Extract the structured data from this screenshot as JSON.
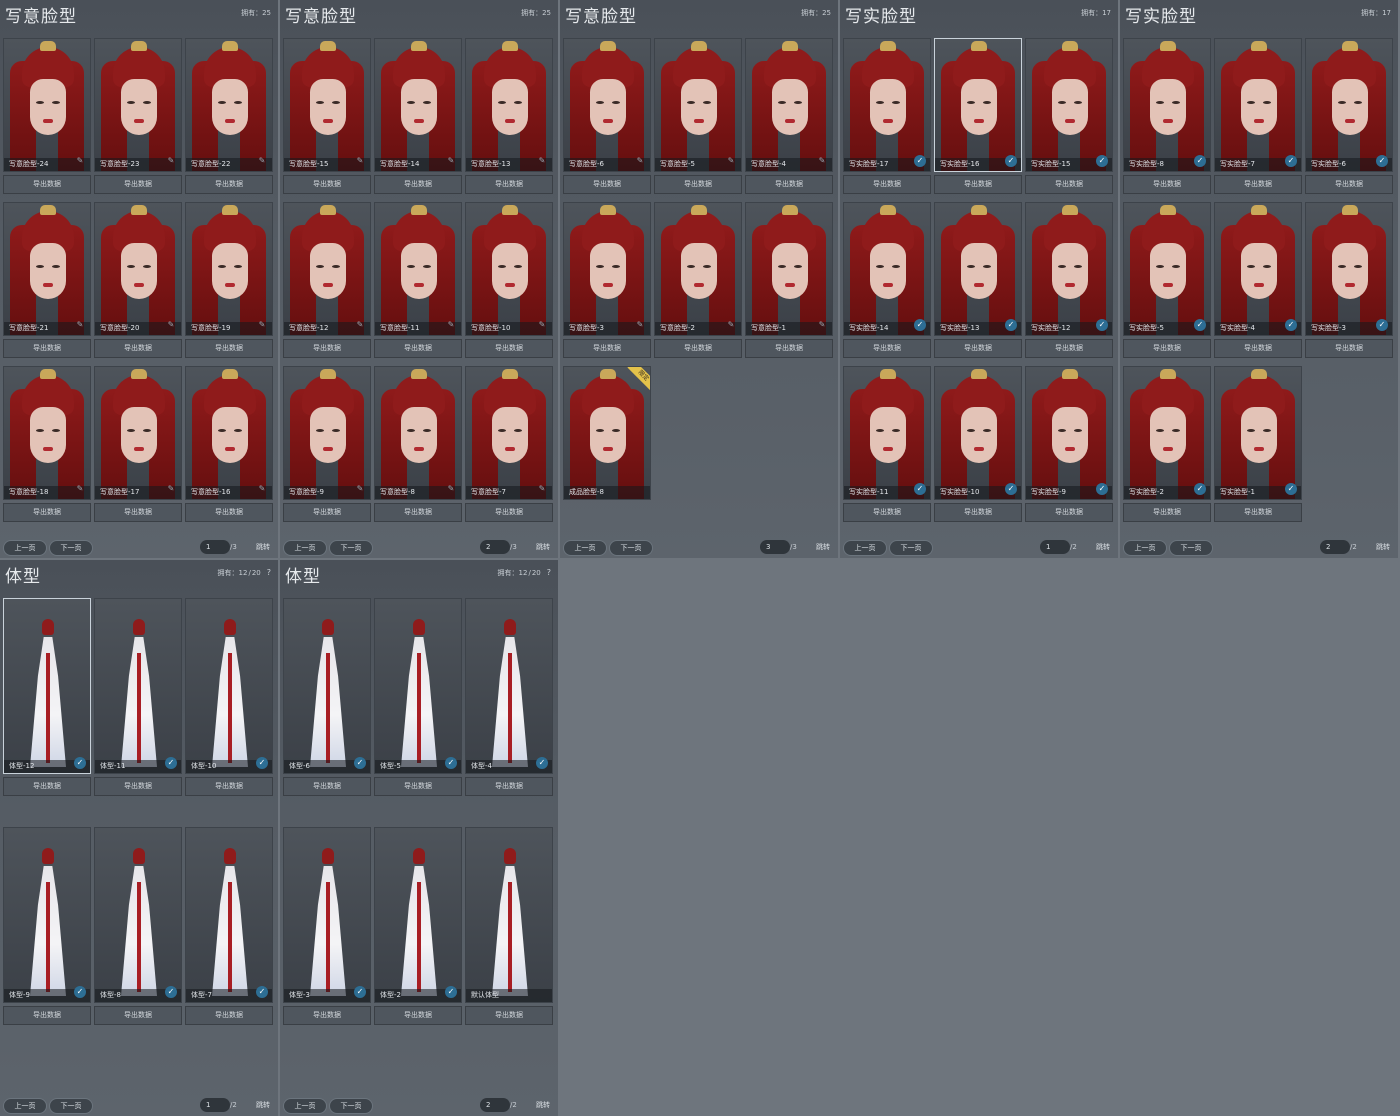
{
  "common": {
    "owned_label": "拥有：",
    "export_label": "导出数据",
    "prev_label": "上一页",
    "next_label": "下一页",
    "jump_label": "跳转",
    "help_label": "?"
  },
  "face_panels": [
    {
      "title": "写意脸型",
      "owned": "25",
      "page": {
        "current": "1",
        "total": "3"
      },
      "items": [
        {
          "name": "写意脸型-24",
          "state": "unchecked"
        },
        {
          "name": "写意脸型-23",
          "state": "unchecked"
        },
        {
          "name": "写意脸型-22",
          "state": "unchecked"
        },
        {
          "name": "写意脸型-21",
          "state": "unchecked"
        },
        {
          "name": "写意脸型-20",
          "state": "unchecked"
        },
        {
          "name": "写意脸型-19",
          "state": "unchecked"
        },
        {
          "name": "写意脸型-18",
          "state": "unchecked"
        },
        {
          "name": "写意脸型-17",
          "state": "unchecked"
        },
        {
          "name": "写意脸型-16",
          "state": "unchecked"
        }
      ]
    },
    {
      "title": "写意脸型",
      "owned": "25",
      "page": {
        "current": "2",
        "total": "3"
      },
      "items": [
        {
          "name": "写意脸型-15",
          "state": "unchecked"
        },
        {
          "name": "写意脸型-14",
          "state": "unchecked"
        },
        {
          "name": "写意脸型-13",
          "state": "unchecked"
        },
        {
          "name": "写意脸型-12",
          "state": "unchecked"
        },
        {
          "name": "写意脸型-11",
          "state": "unchecked"
        },
        {
          "name": "写意脸型-10",
          "state": "unchecked"
        },
        {
          "name": "写意脸型-9",
          "state": "unchecked"
        },
        {
          "name": "写意脸型-8",
          "state": "unchecked"
        },
        {
          "name": "写意脸型-7",
          "state": "unchecked"
        }
      ]
    },
    {
      "title": "写意脸型",
      "owned": "25",
      "page": {
        "current": "3",
        "total": "3"
      },
      "items": [
        {
          "name": "写意脸型-6",
          "state": "unchecked"
        },
        {
          "name": "写意脸型-5",
          "state": "unchecked"
        },
        {
          "name": "写意脸型-4",
          "state": "unchecked"
        },
        {
          "name": "写意脸型-3",
          "state": "unchecked"
        },
        {
          "name": "写意脸型-2",
          "state": "unchecked"
        },
        {
          "name": "写意脸型-1",
          "state": "unchecked"
        },
        {
          "name": "成品脸型-8",
          "state": "none",
          "tag": "限定"
        }
      ]
    },
    {
      "title": "写实脸型",
      "owned": "17",
      "page": {
        "current": "1",
        "total": "2"
      },
      "items": [
        {
          "name": "写实脸型-17",
          "state": "checked"
        },
        {
          "name": "写实脸型-16",
          "state": "checked",
          "selected": true
        },
        {
          "name": "写实脸型-15",
          "state": "checked"
        },
        {
          "name": "写实脸型-14",
          "state": "checked"
        },
        {
          "name": "写实脸型-13",
          "state": "checked"
        },
        {
          "name": "写实脸型-12",
          "state": "checked"
        },
        {
          "name": "写实脸型-11",
          "state": "checked"
        },
        {
          "name": "写实脸型-10",
          "state": "checked"
        },
        {
          "name": "写实脸型-9",
          "state": "checked"
        }
      ]
    },
    {
      "title": "写实脸型",
      "owned": "17",
      "page": {
        "current": "2",
        "total": "2"
      },
      "items": [
        {
          "name": "写实脸型-8",
          "state": "checked"
        },
        {
          "name": "写实脸型-7",
          "state": "checked"
        },
        {
          "name": "写实脸型-6",
          "state": "checked"
        },
        {
          "name": "写实脸型-5",
          "state": "checked"
        },
        {
          "name": "写实脸型-4",
          "state": "checked"
        },
        {
          "name": "写实脸型-3",
          "state": "checked"
        },
        {
          "name": "写实脸型-2",
          "state": "checked"
        },
        {
          "name": "写实脸型-1",
          "state": "checked"
        }
      ]
    }
  ],
  "body_panels": [
    {
      "title": "体型",
      "owned": "12",
      "owned_total": "20",
      "page": {
        "current": "1",
        "total": "2"
      },
      "items": [
        {
          "name": "体型-12",
          "state": "checked",
          "selected": true
        },
        {
          "name": "体型-11",
          "state": "checked"
        },
        {
          "name": "体型-10",
          "state": "checked"
        },
        {
          "name": "体型-9",
          "state": "checked"
        },
        {
          "name": "体型-8",
          "state": "checked"
        },
        {
          "name": "体型-7",
          "state": "checked"
        }
      ]
    },
    {
      "title": "体型",
      "owned": "12",
      "owned_total": "20",
      "page": {
        "current": "2",
        "total": "2"
      },
      "items": [
        {
          "name": "体型-6",
          "state": "checked"
        },
        {
          "name": "体型-5",
          "state": "checked"
        },
        {
          "name": "体型-4",
          "state": "checked"
        },
        {
          "name": "体型-3",
          "state": "checked"
        },
        {
          "name": "体型-2",
          "state": "checked"
        },
        {
          "name": "默认体型",
          "state": "none"
        }
      ]
    }
  ]
}
